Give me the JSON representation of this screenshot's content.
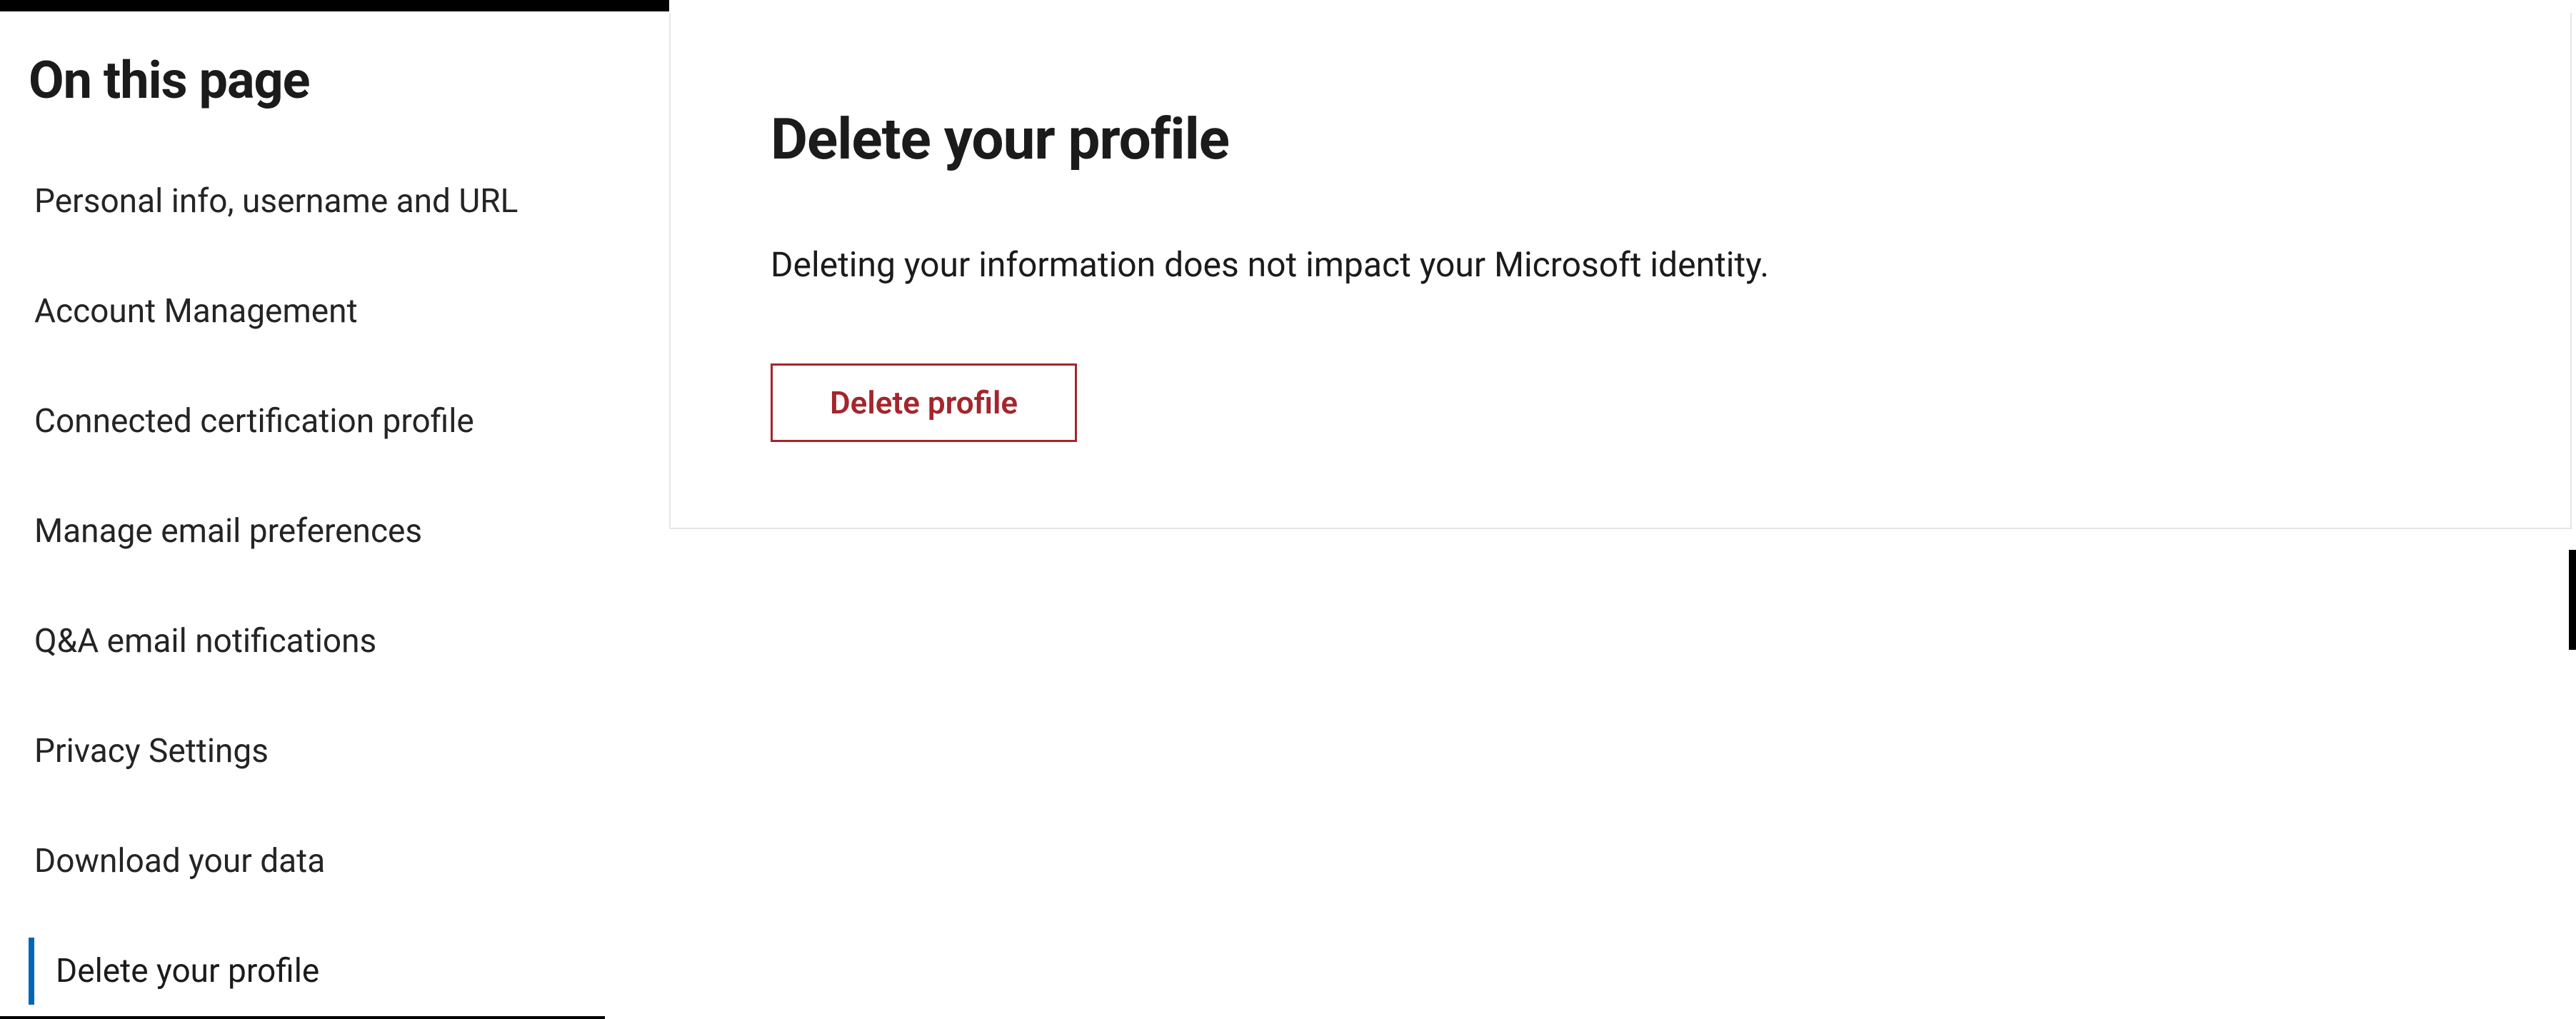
{
  "sidebar": {
    "title": "On this page",
    "items": [
      {
        "label": "Personal info, username and URL",
        "active": false
      },
      {
        "label": "Account Management",
        "active": false
      },
      {
        "label": "Connected certification profile",
        "active": false
      },
      {
        "label": "Manage email preferences",
        "active": false
      },
      {
        "label": "Q&A email notifications",
        "active": false
      },
      {
        "label": "Privacy Settings",
        "active": false
      },
      {
        "label": "Download your data",
        "active": false
      },
      {
        "label": "Delete your profile",
        "active": true
      }
    ]
  },
  "main": {
    "title": "Delete your profile",
    "description": "Deleting your information does not impact your Microsoft identity.",
    "delete_button_label": "Delete profile"
  }
}
